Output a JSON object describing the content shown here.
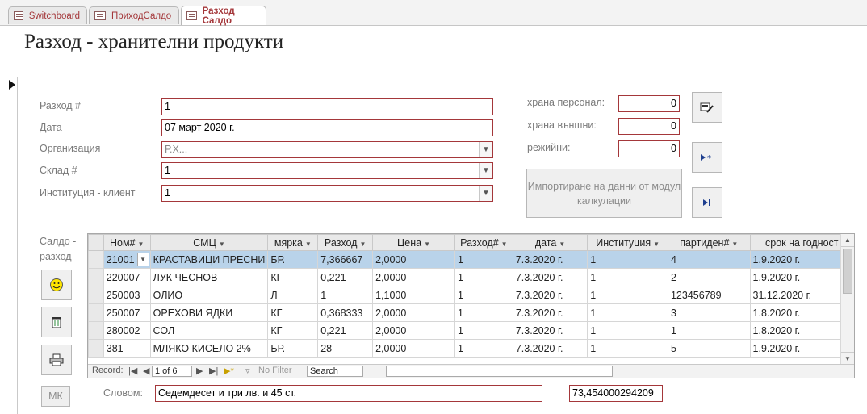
{
  "tabs": [
    {
      "label": "Switchboard",
      "active": false
    },
    {
      "label": "ПриходСалдо",
      "active": false
    },
    {
      "label": "Разход Салдо",
      "active": true
    }
  ],
  "form": {
    "title": "Разход - хранителни продукти",
    "fields": {
      "razhod_label": "Разход #",
      "razhod_value": "1",
      "data_label": "Дата",
      "data_value": "07 март 2020 г.",
      "org_label": "Организация",
      "org_value": "Р.Х...",
      "sklad_label": "Склад #",
      "sklad_value": "1",
      "inst_label": "Институция - клиент",
      "inst_value": "1"
    },
    "right_fields": {
      "personal_label": "храна персонал:",
      "personal_value": "0",
      "vanshni_label": "храна външни:",
      "vanshni_value": "0",
      "rezhiini_label": "режийни:",
      "rezhiini_value": "0"
    },
    "import_button": "Импортиране на данни от модул калкулации",
    "saldo_label": "Салдо - разход",
    "mk_button": "МК",
    "slovom_label": "Словом:",
    "slovom_value": "Седемдесет и три лв. и 45 ст.",
    "total_value": "73,454000294209"
  },
  "datasheet": {
    "columns": [
      "Ном#",
      "СМЦ",
      "мярка",
      "Разход",
      "Цена",
      "Разход#",
      "дата",
      "Институция",
      "партиден#",
      "срок на годност"
    ],
    "rows": [
      [
        "21001",
        "КРАСТАВИЦИ ПРЕСНИ",
        "БР.",
        "7,366667",
        "2,0000",
        "1",
        "7.3.2020 г.",
        "1",
        "4",
        "1.9.2020 г."
      ],
      [
        "220007",
        "ЛУК ЧЕСНОВ",
        "КГ",
        "0,221",
        "2,0000",
        "1",
        "7.3.2020 г.",
        "1",
        "2",
        "1.9.2020 г."
      ],
      [
        "250003",
        "ОЛИО",
        "Л",
        "1",
        "1,1000",
        "1",
        "7.3.2020 г.",
        "1",
        "123456789",
        "31.12.2020 г."
      ],
      [
        "250007",
        "ОРЕХОВИ ЯДКИ",
        "КГ",
        "0,368333",
        "2,0000",
        "1",
        "7.3.2020 г.",
        "1",
        "3",
        "1.8.2020 г."
      ],
      [
        "280002",
        "СОЛ",
        "КГ",
        "0,221",
        "2,0000",
        "1",
        "7.3.2020 г.",
        "1",
        "1",
        "1.8.2020 г."
      ],
      [
        "381",
        "МЛЯКО КИСЕЛО 2%",
        "БР.",
        "28",
        "2,0000",
        "1",
        "7.3.2020 г.",
        "1",
        "5",
        "1.9.2020 г."
      ]
    ],
    "nav": {
      "record_label": "Record:",
      "position": "1 of 6",
      "no_filter": "No Filter",
      "search": "Search"
    }
  }
}
